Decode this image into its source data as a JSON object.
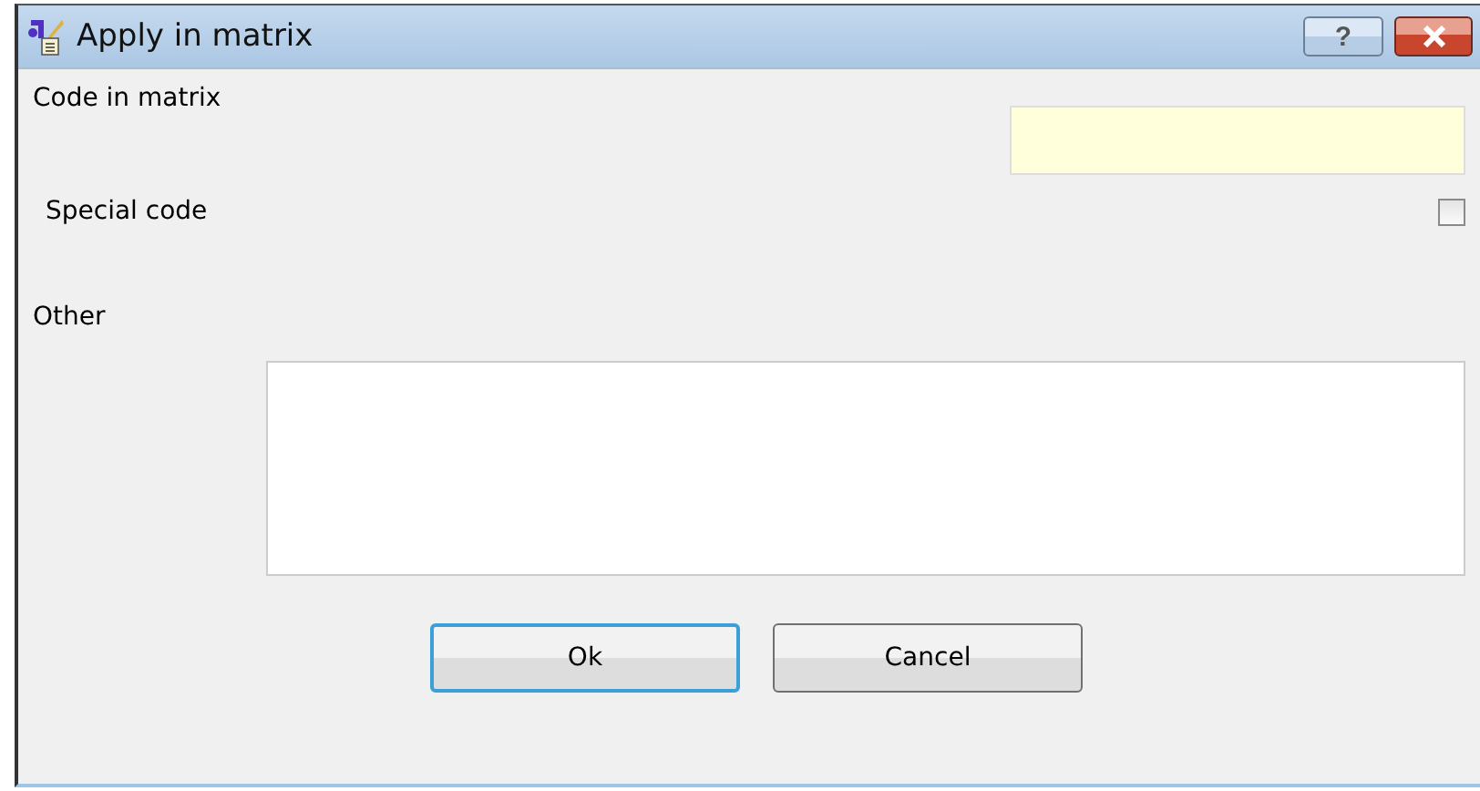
{
  "window": {
    "title": "Apply in matrix",
    "help_button": "?"
  },
  "fields": {
    "code_in_matrix": {
      "label": "Code in matrix"
    },
    "special_code": {
      "label": "Special code",
      "checked": false
    },
    "other": {
      "label": "Other"
    }
  },
  "buttons": [
    {
      "label": "Ok",
      "default": true
    },
    {
      "label": "Cancel",
      "default": false
    }
  ]
}
